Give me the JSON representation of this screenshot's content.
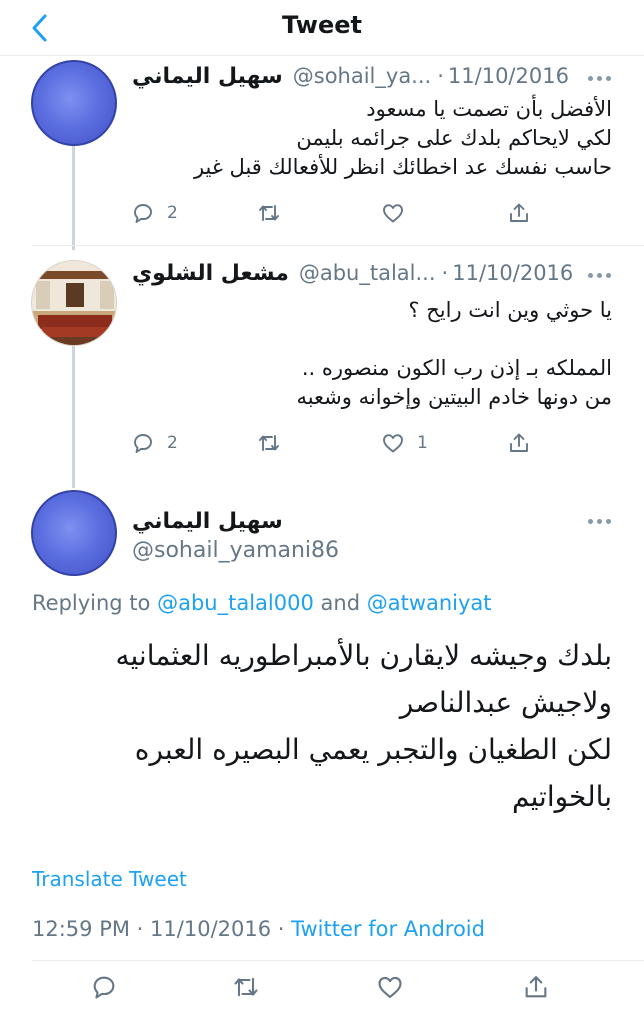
{
  "header": {
    "title": "Tweet"
  },
  "thread": [
    {
      "name": "سهيل اليماني",
      "handle": "@sohail_ya...",
      "date": "11/10/2016",
      "lines": [
        "الأفضل بأن تصمت يا مسعود",
        "لكي لايحاكم بلدك على جرائمه بليمن",
        "حاسب نفسك عد اخطائك انظر للأفعالك قبل غير"
      ],
      "reply_count": "2",
      "retweet_count": "",
      "like_count": ""
    },
    {
      "name": "مشعل الشلوي",
      "handle": "@abu_talal...",
      "date": "11/10/2016",
      "lines": [
        "يا حوثي وين انت رايح ؟",
        "",
        "المملكه بـ إذن رب الكون منصوره ..",
        "من دونها  خادم البيتين  وإخوانه وشعبه"
      ],
      "reply_count": "2",
      "retweet_count": "",
      "like_count": "1"
    }
  ],
  "main_tweet": {
    "name": "سهيل اليماني",
    "handle": "@sohail_yamani86",
    "replying_prefix": "Replying to",
    "mention1": "@abu_talal000",
    "and_text": "and",
    "mention2": "@atwaniyat",
    "lines": [
      "بلدك وجيشه لايقارن بالأمبراطوريه العثمانيه",
      "ولاجيش عبدالناصر",
      "لكن الطغيان والتجبر يعمي البصيره العبره",
      "بالخواتيم"
    ],
    "translate_label": "Translate Tweet",
    "time": "12:59 PM",
    "date": "11/10/2016",
    "source": "Twitter for Android"
  },
  "icons": {
    "back": "chevron-left-icon",
    "reply": "reply-icon",
    "retweet": "retweet-icon",
    "like": "heart-icon",
    "share": "share-icon",
    "more": "more-icon"
  },
  "colors": {
    "accent": "#1da1f2",
    "secondary_text": "#657786",
    "divider": "#e6ecf0"
  }
}
